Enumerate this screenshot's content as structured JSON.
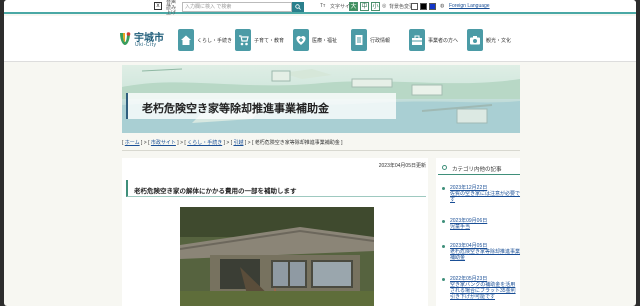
{
  "topbar": {
    "sitemap_icon": "sitemap-icon",
    "small_label": "音声\n読み上げ",
    "search_placeholder": "入力欄に検入  で検索",
    "font_size_label": "文字サイズ",
    "font_sizes": [
      "大",
      "中",
      "小"
    ],
    "color_label": "背景色変更",
    "language_label": "Foreign Language",
    "accent_color": "#4aa8a5"
  },
  "header": {
    "logo_name": "宇城市",
    "logo_sub": "Uki-City",
    "nav": [
      {
        "label": "くらし・手続き",
        "icon": "house-icon"
      },
      {
        "label": "子育て・教育",
        "icon": "stroller-icon"
      },
      {
        "label": "医療・福祉",
        "icon": "medical-heart-icon"
      },
      {
        "label": "行政情報",
        "icon": "document-icon"
      },
      {
        "label": "事業者の方へ",
        "icon": "briefcase-icon"
      },
      {
        "label": "観光・文化",
        "icon": "camera-icon"
      }
    ]
  },
  "hero": {
    "title": "老朽危険空き家等除却推進事業補助金"
  },
  "breadcrumb": {
    "items": [
      "ホーム",
      "市政サイト",
      "くらし・手続き",
      "引越",
      "老朽危険空き家等除却推進事業補助金"
    ]
  },
  "main": {
    "updated": "2023年04月05日更新",
    "article_title": "老朽危険空き家の解体にかかる費用の一部を補助します"
  },
  "sidebar": {
    "heading": "カテゴリ内他の記事",
    "items": [
      {
        "date": "2023年12月22日",
        "title": "佐賀の空き家には注意が必要です"
      },
      {
        "date": "2023年09月06日",
        "title": "児童手当"
      },
      {
        "date": "2023年04月05日",
        "title": "老朽危険空き家等除却推進事業補助金"
      },
      {
        "date": "2022年05月23日",
        "title": "空き家バンクの補助金を活用される場合にフラット35金利引き下げが可能です"
      }
    ]
  }
}
